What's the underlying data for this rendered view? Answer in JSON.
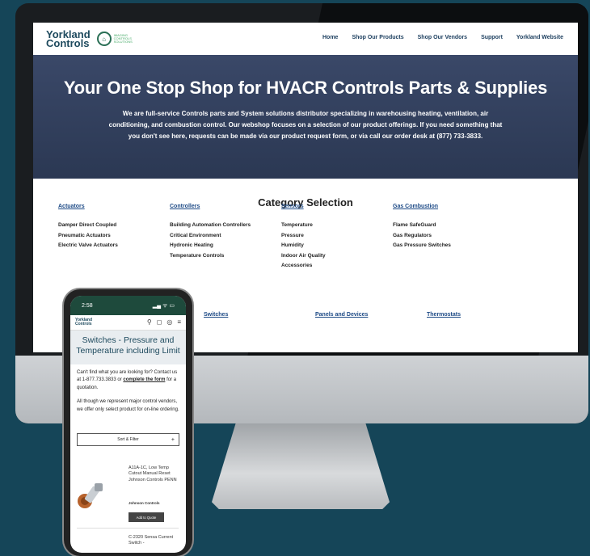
{
  "nav": {
    "logo_line1": "Yorkland",
    "logo_line2": "Controls",
    "logo_small": "IMAGING CONTROLS SOLUTIONS",
    "links": [
      "Home",
      "Shop Our Products",
      "Shop Our Vendors",
      "Support",
      "Yorkland Website"
    ]
  },
  "hero": {
    "title": "Your One Stop Shop for HVACR Controls Parts & Supplies",
    "body": "We are full-service Controls parts and System solutions distributor specializing in warehousing heating, ventilation, air conditioning, and combustion control. Our webshop focuses on a selection of our product offerings. If you need something that you don't see here, requests can be made via our product request form, or via call our order desk at (877) 733-3833."
  },
  "categories": {
    "title": "Category Selection",
    "columns": [
      {
        "heading": "Actuators",
        "items": [
          "Damper Direct Coupled",
          "Pneumatic Actuators",
          "Electric Valve Actuators"
        ]
      },
      {
        "heading": "Controllers",
        "items": [
          "Building Automation Controllers",
          "Critical Environment",
          "Hydronic Heating",
          "Temperature Controls"
        ]
      },
      {
        "heading": "Sensors",
        "items": [
          "Temperature",
          "Pressure",
          "Humidity",
          "Indoor Air Quality",
          "Accessories"
        ]
      },
      {
        "heading": "Gas Combustion",
        "items": [
          "Flame SafeGuard",
          "Gas Regulators",
          "Gas Pressure Switches"
        ]
      }
    ],
    "row2": [
      "Switches",
      "Panels and Devices",
      "Thermostats"
    ]
  },
  "phone": {
    "time": "2:58",
    "status_icons": "▂▄ ᯤ ▭",
    "logo": "Yorkland Controls",
    "page_title": "Switches - Pressure and Temperature including Limit",
    "p1_a": "Can't find what you are looking for? Contact us at 1-877.733.3833 or",
    "p1_link": "complete the form",
    "p1_b": "for a quotation.",
    "p2": "All though we represent major control vendors, we offer only select product for on-line ordering.",
    "filter_label": "Sort & Filter",
    "filter_plus": "+",
    "product1_name": "A11A-1C, Low Temp Cutout Manual Reset Johnson Controls PENN",
    "product1_brand": "Johnson Controls",
    "product1_button": "Add to Quote",
    "product2_name": "C-2320 Sensa Current Switch -"
  }
}
